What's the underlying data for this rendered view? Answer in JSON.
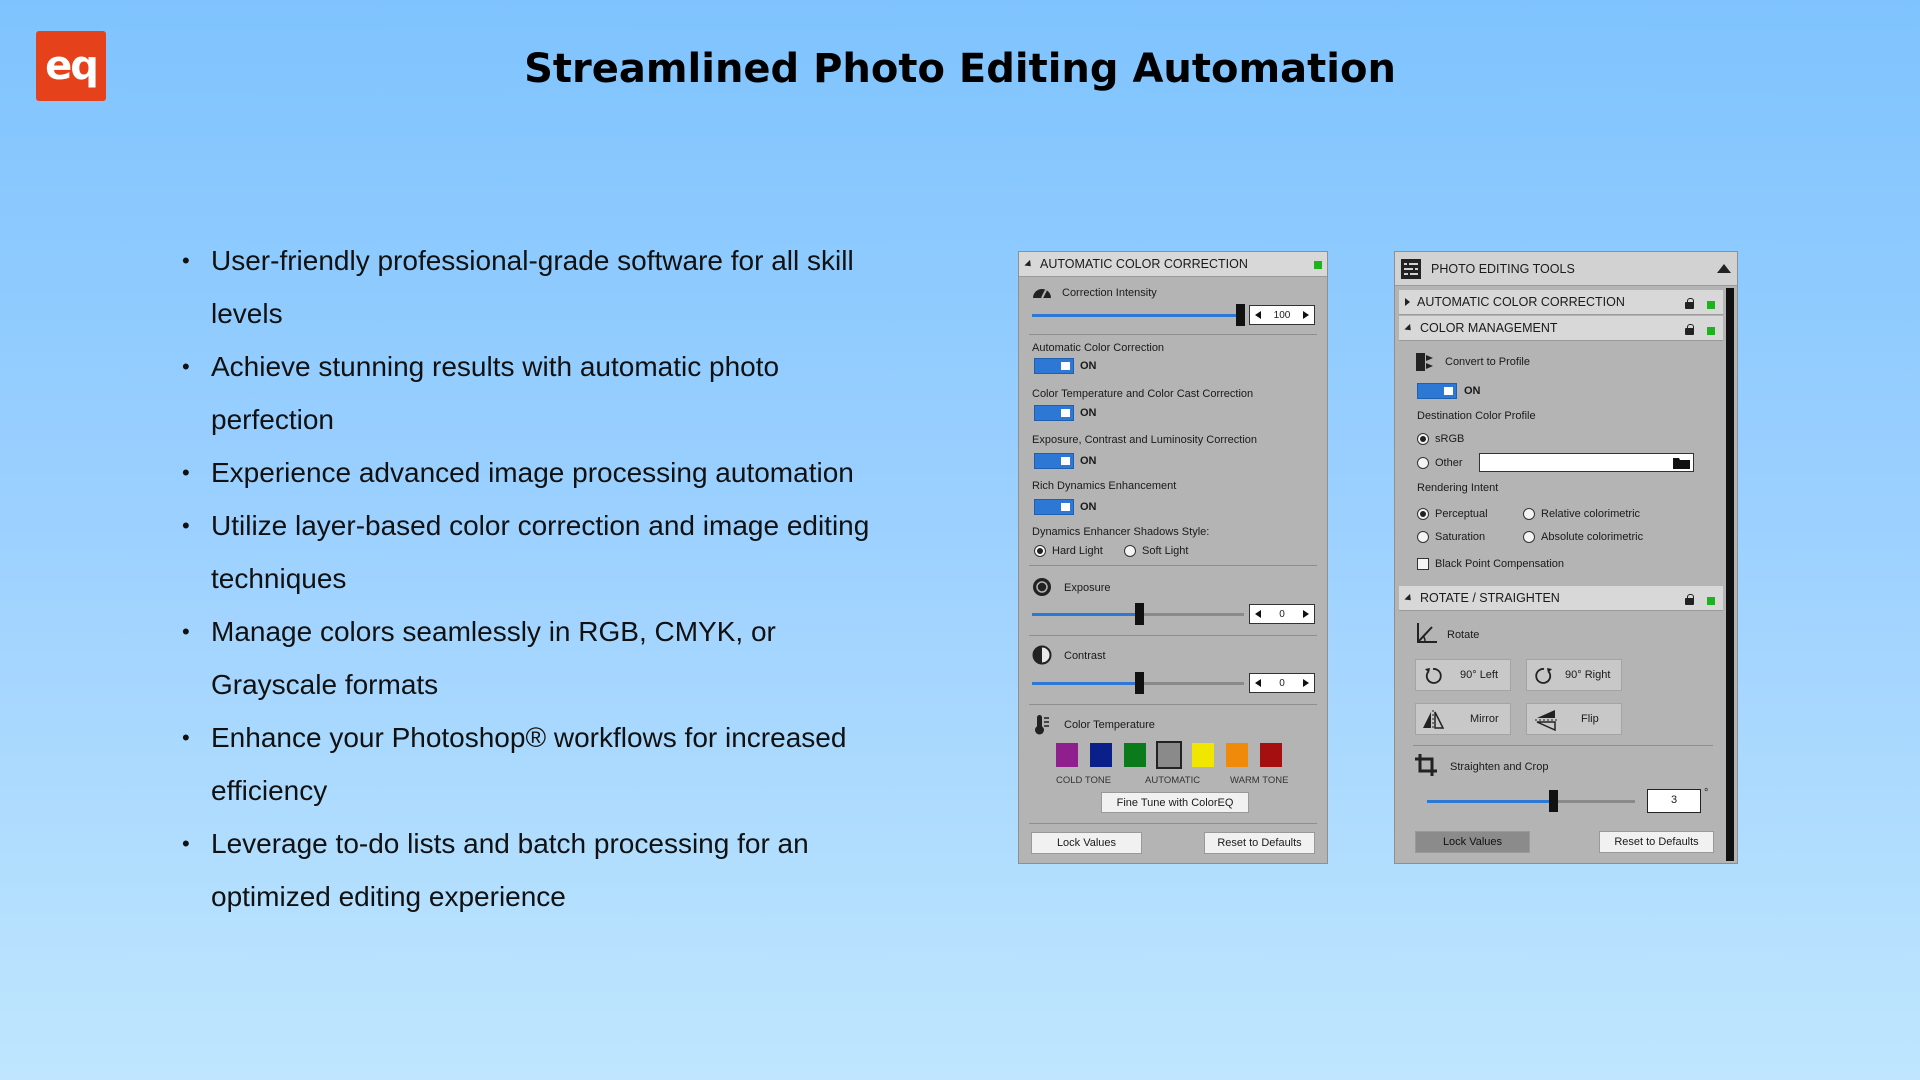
{
  "logo": {
    "text": "eq",
    "color": "#e5421b"
  },
  "title": "Streamlined Photo Editing Automation",
  "bullets": [
    "User-friendly professional-grade software for all skill levels",
    "Achieve stunning results with automatic photo perfection",
    "Experience advanced image processing automation",
    "Utilize layer-based color correction and image editing techniques",
    "Manage colors seamlessly in RGB, CMYK, or Grayscale formats",
    "Enhance your Photoshop® workflows for increased efficiency",
    "Leverage to-do lists and batch processing for an optimized editing experience"
  ],
  "panel1": {
    "header": "AUTOMATIC COLOR CORRECTION",
    "correction_intensity": {
      "label": "Correction Intensity",
      "value": "100"
    },
    "auto_color": {
      "label": "Automatic Color Correction",
      "state": "ON"
    },
    "color_temp_cast": {
      "label": "Color Temperature and Color Cast Correction",
      "state": "ON"
    },
    "exposure_contrast": {
      "label": "Exposure, Contrast and Luminosity Correction",
      "state": "ON"
    },
    "rich_dynamics": {
      "label": "Rich Dynamics Enhancement",
      "state": "ON"
    },
    "shadows_style": {
      "label": "Dynamics Enhancer Shadows Style:",
      "options": [
        "Hard Light",
        "Soft Light"
      ],
      "selected": "Hard Light"
    },
    "exposure": {
      "label": "Exposure",
      "value": "0"
    },
    "contrast": {
      "label": "Contrast",
      "value": "0"
    },
    "color_temperature": {
      "label": "Color Temperature",
      "swatches": [
        "#8e1f8c",
        "#0a1f8a",
        "#0b7a1a",
        "#8a8a8a",
        "#f0e600",
        "#ef8a0a",
        "#a50f0f"
      ],
      "selected_index": 3,
      "cold_label": "COLD TONE",
      "auto_label": "AUTOMATIC",
      "warm_label": "WARM TONE",
      "fine_tune": "Fine Tune with ColorEQ"
    },
    "lock_values": "Lock Values",
    "reset": "Reset to Defaults"
  },
  "panel2": {
    "header": "PHOTO EDITING TOOLS",
    "section_acc": "AUTOMATIC COLOR CORRECTION",
    "section_cm": "COLOR MANAGEMENT",
    "convert_to_profile": {
      "label": "Convert to Profile",
      "state": "ON"
    },
    "destination_profile": {
      "label": "Destination Color Profile",
      "srgb": "sRGB",
      "other": "Other",
      "selected": "sRGB"
    },
    "rendering_intent": {
      "label": "Rendering Intent",
      "options": [
        "Perceptual",
        "Relative colorimetric",
        "Saturation",
        "Absolute colorimetric"
      ],
      "selected": "Perceptual"
    },
    "black_point": "Black Point Compensation",
    "section_rotate": "ROTATE / STRAIGHTEN",
    "rotate_label": "Rotate",
    "left90": "90° Left",
    "right90": "90° Right",
    "mirror": "Mirror",
    "flip": "Flip",
    "straighten": {
      "label": "Straighten and Crop",
      "value": "3",
      "unit": "°"
    },
    "lock_values": "Lock Values",
    "reset": "Reset to Defaults"
  }
}
